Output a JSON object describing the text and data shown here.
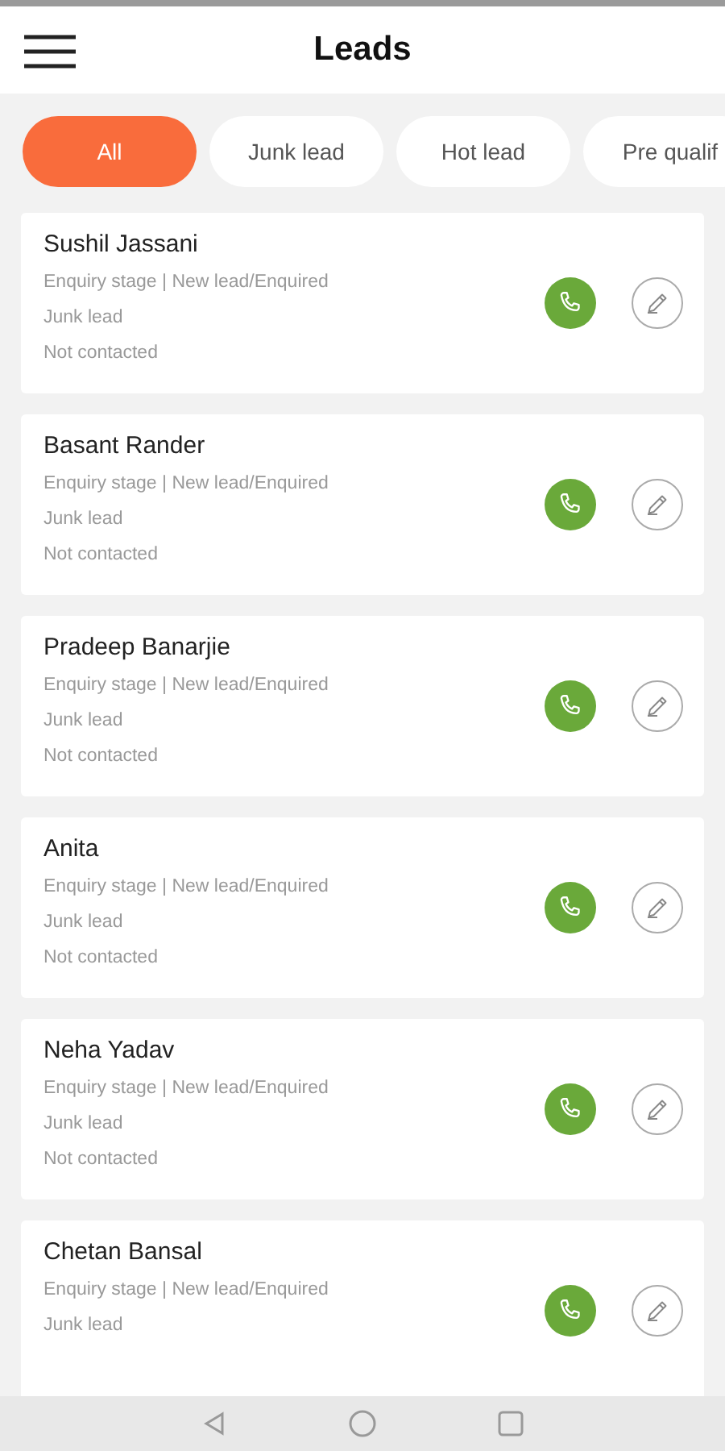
{
  "header": {
    "title": "Leads"
  },
  "filters": [
    {
      "label": "All",
      "selected": true
    },
    {
      "label": "Junk lead",
      "selected": false
    },
    {
      "label": "Hot lead",
      "selected": false
    },
    {
      "label": "Pre qualif",
      "selected": false
    }
  ],
  "leads": [
    {
      "name": "Sushil Jassani",
      "stage": "Enquiry stage | New lead/Enquired",
      "type": "Junk lead",
      "status": "Not contacted"
    },
    {
      "name": "Basant Rander",
      "stage": "Enquiry stage | New lead/Enquired",
      "type": "Junk lead",
      "status": "Not contacted"
    },
    {
      "name": "Pradeep Banarjie",
      "stage": "Enquiry stage | New lead/Enquired",
      "type": "Junk lead",
      "status": "Not contacted"
    },
    {
      "name": "Anita",
      "stage": "Enquiry stage | New lead/Enquired",
      "type": "Junk lead",
      "status": "Not contacted"
    },
    {
      "name": "Neha Yadav",
      "stage": "Enquiry stage | New lead/Enquired",
      "type": "Junk lead",
      "status": "Not contacted"
    },
    {
      "name": "Chetan Bansal",
      "stage": "Enquiry stage | New lead/Enquired",
      "type": "Junk lead"
    }
  ]
}
